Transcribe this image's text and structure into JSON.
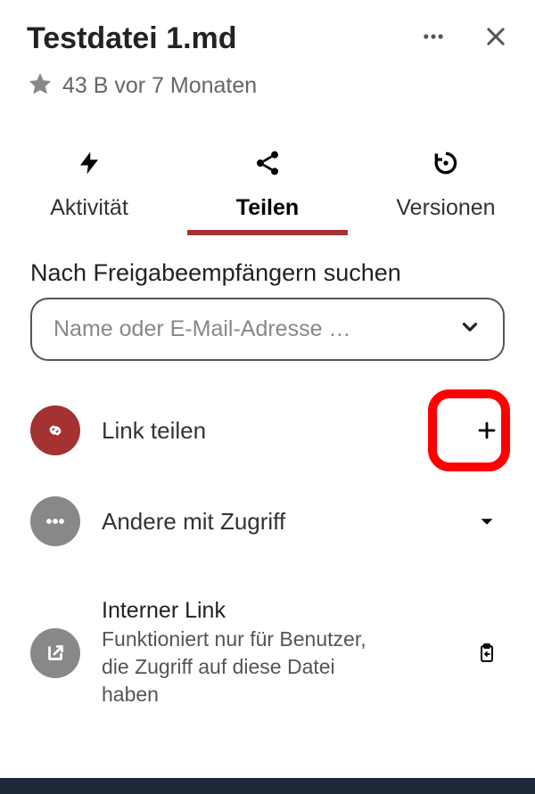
{
  "header": {
    "title": "Testdatei 1.md",
    "meta": "43 B vor 7 Monaten"
  },
  "tabs": {
    "activity": "Aktivität",
    "share": "Teilen",
    "versions": "Versionen"
  },
  "search": {
    "label": "Nach Freigabeempfängern suchen",
    "placeholder": "Name oder E-Mail-Adresse …"
  },
  "shareLink": {
    "label": "Link teilen"
  },
  "othersAccess": {
    "label": "Andere mit Zugriff"
  },
  "internalLink": {
    "title": "Interner Link",
    "sub": "Funktioniert nur für Benutzer, die Zugriff auf diese Datei haben"
  }
}
